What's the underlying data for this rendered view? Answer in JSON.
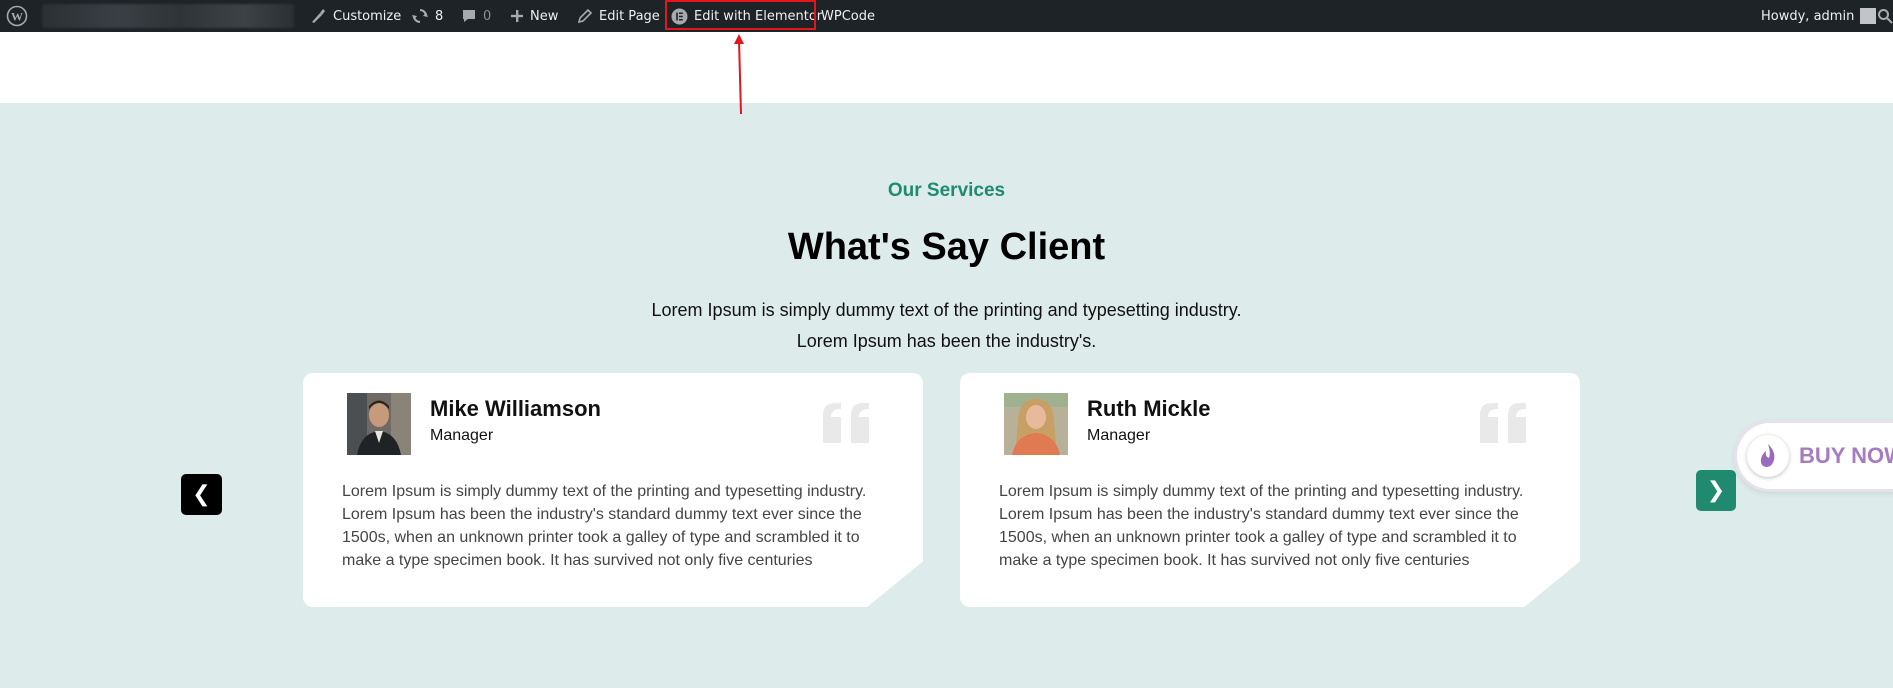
{
  "admin_bar": {
    "customize_label": "Customize",
    "updates_count": "8",
    "comments_count": "0",
    "new_label": "New",
    "edit_page_label": "Edit Page",
    "edit_elementor_label": "Edit with Elementor",
    "wpcode_label": "WPCode",
    "howdy_label": "Howdy, admin"
  },
  "section": {
    "subheading": "Our Services",
    "heading": "What's Say Client",
    "intro_line1": "Lorem Ipsum is simply dummy text of the printing and typesetting industry.",
    "intro_line2": "Lorem Ipsum has been the industry's."
  },
  "testimonials": [
    {
      "name": "Mike Williamson",
      "role": "Manager",
      "text": "Lorem Ipsum is simply dummy text of the printing and typesetting industry. Lorem Ipsum has been the industry's standard dummy text ever since the 1500s, when an unknown printer took a galley of type and scrambled it to make a type specimen book. It has survived not only five centuries"
    },
    {
      "name": "Ruth Mickle",
      "role": "Manager",
      "text": "Lorem Ipsum is simply dummy text of the printing and typesetting industry. Lorem Ipsum has been the industry's standard dummy text ever since the 1500s, when an unknown printer took a galley of type and scrambled it to make a type specimen book. It has survived not only five centuries"
    }
  ],
  "nav": {
    "prev_glyph": "❮",
    "next_glyph": "❯"
  },
  "buy_now": {
    "label": "BUY NOW"
  },
  "colors": {
    "accent": "#1f8a70",
    "admin_bar_bg": "#1d2327",
    "section_bg": "#ddecea",
    "highlight": "#e3161b",
    "buy_now_text": "#a77bbf"
  }
}
